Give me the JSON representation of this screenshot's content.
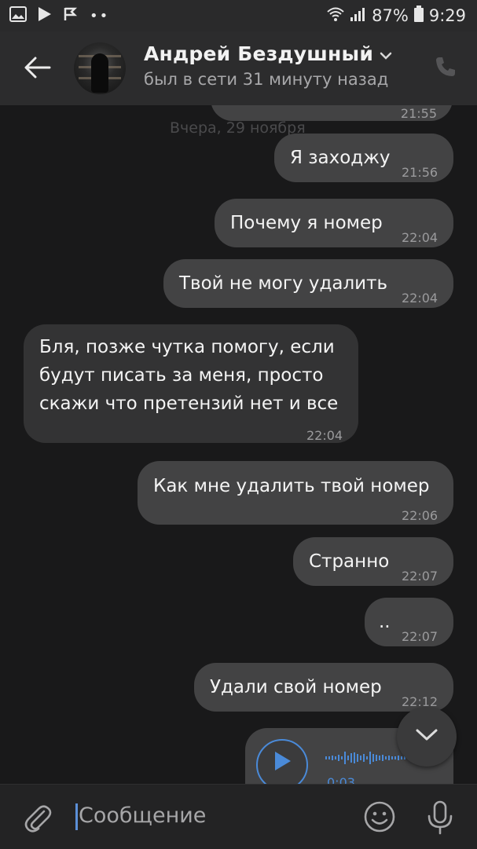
{
  "statusbar": {
    "battery_percent": "87%",
    "time": "9:29",
    "icons": [
      "gallery-icon",
      "play-store-icon",
      "check-flag-icon",
      "more-dots-icon",
      "wifi-icon",
      "signal-icon",
      "battery-icon"
    ]
  },
  "header": {
    "name": "Андрей Бездушный",
    "status": "был в сети 31 минуту назад",
    "icons": [
      "back-arrow-icon",
      "chevron-down-icon",
      "phone-icon"
    ]
  },
  "chat": {
    "date_separator": "Вчера, 29 ноября",
    "messages": [
      {
        "dir": "out",
        "text": "",
        "time": "21:55"
      },
      {
        "dir": "out",
        "text": "Я заходжу",
        "time": "21:56"
      },
      {
        "dir": "out",
        "text": "Почему я номер",
        "time": "22:04"
      },
      {
        "dir": "out",
        "text": "Твой не могу удалить",
        "time": "22:04"
      },
      {
        "dir": "in",
        "text": "Бля, позже чутка помогу, если\nбудут писать за меня, просто\nскажи что претензий нет и все",
        "time": "22:04"
      },
      {
        "dir": "out",
        "text": "Как мне удалить твой номер",
        "time": "22:06"
      },
      {
        "dir": "out",
        "text": "Странно",
        "time": "22:07"
      },
      {
        "dir": "out",
        "text": "..",
        "time": "22:07"
      },
      {
        "dir": "out",
        "text": "Удали свой номер",
        "time": "22:12"
      }
    ],
    "voice_message": {
      "duration": "0:03"
    }
  },
  "composer": {
    "placeholder": "Сообщение",
    "icons": [
      "paperclip-icon",
      "emoji-icon",
      "microphone-icon"
    ]
  },
  "colors": {
    "background": "#19191a",
    "bubble_out": "#434344",
    "bubble_in": "#333334",
    "accent": "#5b8fd8"
  }
}
